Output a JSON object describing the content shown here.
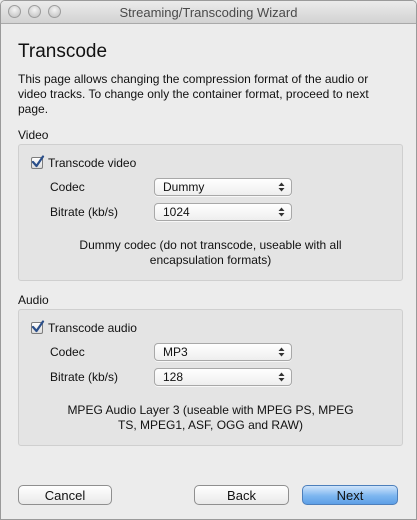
{
  "window": {
    "title": "Streaming/Transcoding Wizard"
  },
  "page": {
    "heading": "Transcode",
    "description": "This page allows changing the compression format of the audio or video tracks. To change only the container format, proceed to next page."
  },
  "video": {
    "section_label": "Video",
    "checkbox_label": "Transcode video",
    "checked": true,
    "codec_label": "Codec",
    "codec_value": "Dummy",
    "bitrate_label": "Bitrate (kb/s)",
    "bitrate_value": "1024",
    "info": "Dummy codec (do not transcode, useable with all encapsulation formats)"
  },
  "audio": {
    "section_label": "Audio",
    "checkbox_label": "Transcode audio",
    "checked": true,
    "codec_label": "Codec",
    "codec_value": "MP3",
    "bitrate_label": "Bitrate (kb/s)",
    "bitrate_value": "128",
    "info": "MPEG Audio Layer 3 (useable with MPEG PS, MPEG TS, MPEG1, ASF, OGG and RAW)"
  },
  "buttons": {
    "cancel": "Cancel",
    "back": "Back",
    "next": "Next"
  },
  "colors": {
    "primary_button": "#7db6f0",
    "checkmark": "#2b4f8a"
  }
}
